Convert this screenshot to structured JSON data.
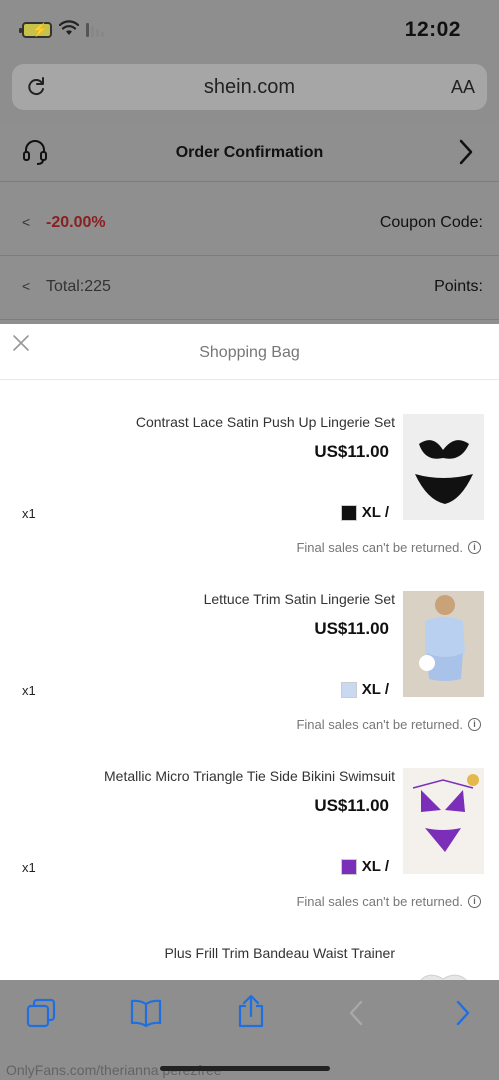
{
  "status_bar": {
    "time": "12:02"
  },
  "browser": {
    "url": "shein.com",
    "text_size_label": "AA"
  },
  "page": {
    "title": "Order Confirmation",
    "coupon": {
      "label": "Coupon Code:",
      "value": "-20.00%"
    },
    "points": {
      "label": "Points:",
      "value": "Total:225"
    }
  },
  "sheet": {
    "title": "Shopping Bag",
    "items": [
      {
        "name": "Contrast Lace Satin Push Up Lingerie Set",
        "price": "US$11.00",
        "size": "XL /",
        "qty": "x1",
        "note": "Final sales can't be returned.",
        "swatch_color": "#111111"
      },
      {
        "name": "Lettuce Trim Satin Lingerie Set",
        "price": "US$11.00",
        "size": "XL /",
        "qty": "x1",
        "note": "Final sales can't be returned.",
        "swatch_color": "#c9d9f2"
      },
      {
        "name": "Metallic Micro Triangle Tie Side Bikini Swimsuit",
        "price": "US$11.00",
        "size": "XL /",
        "qty": "x1",
        "note": "Final sales can't be returned.",
        "swatch_color": "#7b2fb8"
      },
      {
        "name": "Plus Frill Trim Bandeau Waist Trainer"
      }
    ]
  },
  "watermark": "OnlyFans.com/therianna perezfree",
  "colors": {
    "accent_blue": "#1f6fe0",
    "coupon_red": "#8a1f1f"
  }
}
